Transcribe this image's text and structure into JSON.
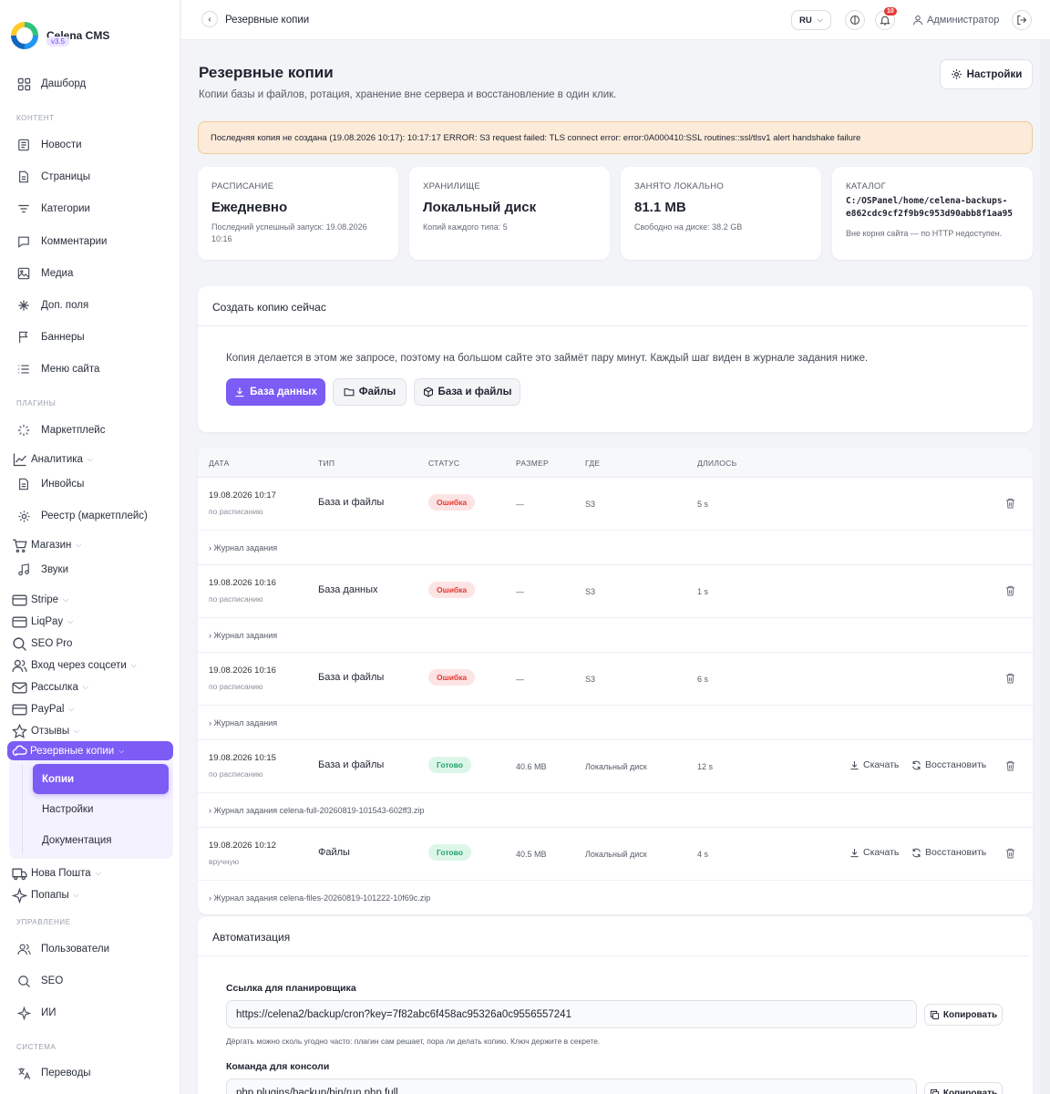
{
  "app": {
    "name": "Celena CMS",
    "version": "v3.5"
  },
  "sidebar": {
    "dashboard": "Дашборд",
    "section_content": "КОНТЕНТ",
    "content": [
      "Новости",
      "Страницы",
      "Категории",
      "Комментарии",
      "Медиа",
      "Доп. поля",
      "Баннеры",
      "Меню сайта"
    ],
    "section_plugins": "ПЛАГИНЫ",
    "plugins": [
      "Маркетплейс",
      "Аналитика",
      "Инвойсы",
      "Реестр (маркетплейс)",
      "Магазин",
      "Звуки",
      "Stripe",
      "LiqPay",
      "SEO Pro",
      "Вход через соцсети",
      "Рассылка",
      "PayPal",
      "Отзывы",
      "Резервные копии",
      "Нова Пошта",
      "Попапы"
    ],
    "backup_sub": [
      "Копии",
      "Настройки",
      "Документация"
    ],
    "section_manage": "УПРАВЛЕНИЕ",
    "manage": [
      "Пользователи",
      "SEO",
      "ИИ"
    ],
    "section_system": "СИСТЕМА",
    "system": [
      "Переводы"
    ]
  },
  "topbar": {
    "breadcrumb": "Резервные копии",
    "lang": "RU",
    "notifications": "10",
    "user": "Администратор"
  },
  "page": {
    "title": "Резервные копии",
    "subtitle": "Копии базы и файлов, ротация, хранение вне сервера и восстановление в один клик.",
    "settings_button": "Настройки",
    "alert": "Последняя копия не создана (19.08.2026 10:17): 10:17:17 ERROR: S3 request failed: TLS connect error: error:0A000410:SSL routines::ssl/tlsv1 alert handshake failure"
  },
  "stats": [
    {
      "label": "РАСПИСАНИЕ",
      "value": "Ежедневно",
      "note": "Последний успешный запуск: 19.08.2026 10:16"
    },
    {
      "label": "ХРАНИЛИЩЕ",
      "value": "Локальный диск",
      "note": "Копий каждого типа: 5"
    },
    {
      "label": "ЗАНЯТО ЛОКАЛЬНО",
      "value": "81.1 MB",
      "note": "Свободно на диске: 38.2 GB"
    },
    {
      "label": "КАТАЛОГ",
      "path1": "C:/OSPanel/home/celena-backups-",
      "path2": "e862cdc9cf2f9b9c953d90abb8f1aa95",
      "note": "Вне корня сайта — по HTTP недоступен."
    }
  ],
  "create": {
    "title": "Создать копию сейчас",
    "text": "Копия делается в этом же запросе, поэтому на большом сайте это займёт пару минут. Каждый шаг виден в журнале задания ниже.",
    "btn_db": "База данных",
    "btn_files": "Файлы",
    "btn_both": "База и файлы"
  },
  "table": {
    "headers": [
      "ДАТА",
      "ТИП",
      "СТАТУС",
      "РАЗМЕР",
      "ГДЕ",
      "ДЛИЛОСЬ"
    ],
    "download_label": "Скачать",
    "restore_label": "Восстановить",
    "rows": [
      {
        "date": "19.08.2026 10:17",
        "source": "по расписанию",
        "type": "База и файлы",
        "status": "Ошибка",
        "size": "—",
        "where": "S3",
        "duration": "5 s",
        "log": "› Журнал задания"
      },
      {
        "date": "19.08.2026 10:16",
        "source": "по расписанию",
        "type": "База данных",
        "status": "Ошибка",
        "size": "—",
        "where": "S3",
        "duration": "1 s",
        "log": "› Журнал задания"
      },
      {
        "date": "19.08.2026 10:16",
        "source": "по расписанию",
        "type": "База и файлы",
        "status": "Ошибка",
        "size": "—",
        "where": "S3",
        "duration": "6 s",
        "log": "› Журнал задания"
      },
      {
        "date": "19.08.2026 10:15",
        "source": "по расписанию",
        "type": "База и файлы",
        "status": "Готово",
        "size": "40.6 MB",
        "where": "Локальный диск",
        "duration": "12 s",
        "log": "› Журнал задания celena-full-20260819-101543-602ff3.zip"
      },
      {
        "date": "19.08.2026 10:12",
        "source": "вручную",
        "type": "Файлы",
        "status": "Готово",
        "size": "40.5 MB",
        "where": "Локальный диск",
        "duration": "4 s",
        "log": "› Журнал задания celena-files-20260819-101222-10f69c.zip"
      }
    ]
  },
  "automation": {
    "title": "Автоматизация",
    "cron_label": "Ссылка для планировщика",
    "cron_url": "https://celena2/backup/cron?key=7f82abc6f458ac95326a0c9556557241",
    "copy": "Копировать",
    "cron_hint": "Дёргать можно сколь угодно часто: плагин сам решает, пора ли делать копию. Ключ держите в секрете.",
    "console_label": "Команда для консоли",
    "console_cmd": "php plugins/backup/bin/run.php full"
  },
  "colors": {
    "accent": "#7c5cf5",
    "error": "#e53935",
    "success": "#1ea267",
    "alert_bg": "#fcebd9"
  }
}
